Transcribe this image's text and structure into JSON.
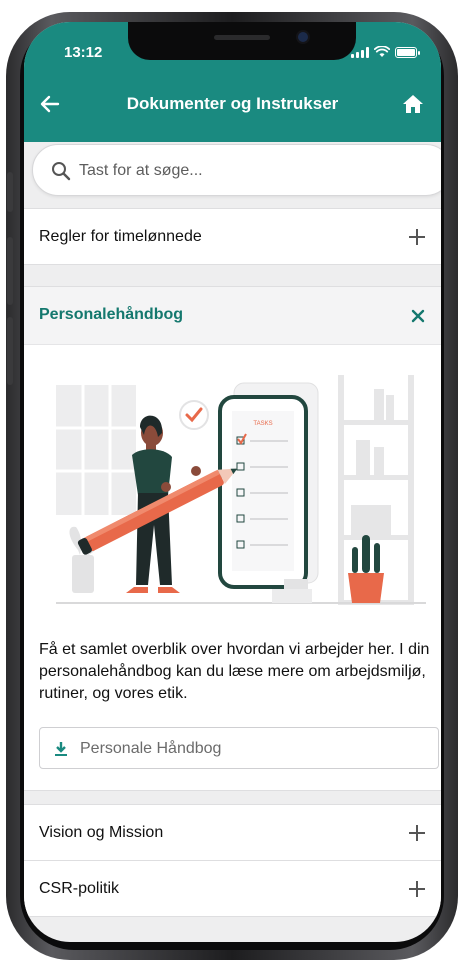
{
  "status": {
    "time": "13:12"
  },
  "header": {
    "title": "Dokumenter og Instrukser",
    "back_icon": "arrow-left-icon",
    "home_icon": "home-icon"
  },
  "search": {
    "placeholder": "Tast for at søge...",
    "value": ""
  },
  "sections": [
    {
      "label": "Regler for timelønnede",
      "expanded": false
    },
    {
      "label": "Personalehåndbog",
      "expanded": true,
      "description": "Få et samlet overblik over hvordan vi arbejder her. I din personalehåndbog kan du læse mere om arbejdsmiljø, rutiner, og vores etik.",
      "download_label": "Personale Håndbog",
      "illustration_text": "TASKS"
    },
    {
      "label": "Vision og Mission",
      "expanded": false
    },
    {
      "label": "CSR-politik",
      "expanded": false
    }
  ],
  "colors": {
    "brand": "#1a8a80",
    "accent": "#e8694a",
    "dark_figure": "#22473f"
  }
}
